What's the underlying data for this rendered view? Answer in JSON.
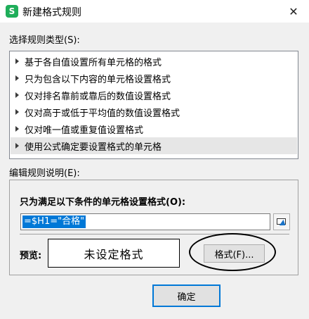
{
  "window": {
    "icon_letter": "S",
    "title": "新建格式规则",
    "close_glyph": "✕"
  },
  "rule_types": {
    "label": "选择规则类型(S):",
    "items": [
      {
        "label": "基于各自值设置所有单元格的格式",
        "selected": false
      },
      {
        "label": "只为包含以下内容的单元格设置格式",
        "selected": false
      },
      {
        "label": "仅对排名靠前或靠后的数值设置格式",
        "selected": false
      },
      {
        "label": "仅对高于或低于平均值的数值设置格式",
        "selected": false
      },
      {
        "label": "仅对唯一值或重复值设置格式",
        "selected": false
      },
      {
        "label": "使用公式确定要设置格式的单元格",
        "selected": true
      }
    ]
  },
  "rule_description": {
    "label": "编辑规则说明(E):",
    "condition_label": "只为满足以下条件的单元格设置格式(O):",
    "formula_value": "=$H1=\"合格\"",
    "preview_label": "预览:",
    "preview_text": "未设定格式",
    "format_button": "格式(F)..."
  },
  "buttons": {
    "ok": "确定"
  },
  "colors": {
    "selection": "#0078d7",
    "app_icon": "#1fae5a",
    "selected_item_bg": "#e6e6e6",
    "annotation_circle": "#000000"
  }
}
